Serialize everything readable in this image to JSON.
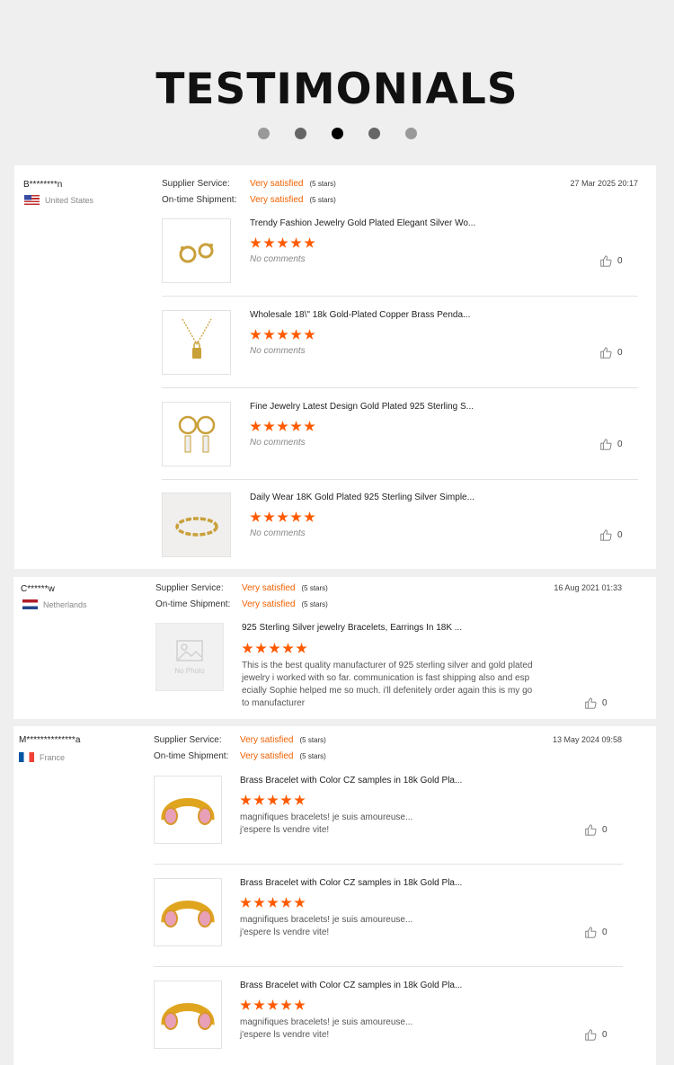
{
  "title": "TESTIMONIALS",
  "colors": {
    "accent": "#f06000",
    "star": "#ff5a00",
    "background": "#efefef"
  },
  "labels": {
    "supplier_service": "Supplier Service:",
    "ontime_shipment": "On-time Shipment:",
    "very_satisfied": "Very satisfied",
    "five_stars": "(5 stars)",
    "no_comments": "No comments",
    "no_photo": "No Photo"
  },
  "reviews": [
    {
      "user": "B********n",
      "country": "United States",
      "flag": "us-flag",
      "date": "27 Mar 2025 20:17",
      "items": [
        {
          "name": "Trendy Fashion Jewelry Gold Plated Elegant Silver Wo...",
          "comment": "No comments",
          "likes": "0",
          "rating": 5
        },
        {
          "name": "Wholesale 18\\\" 18k Gold-Plated Copper Brass Penda...",
          "comment": "No comments",
          "likes": "0",
          "rating": 5
        },
        {
          "name": "Fine Jewelry Latest Design Gold Plated 925 Sterling S...",
          "comment": "No comments",
          "likes": "0",
          "rating": 5
        },
        {
          "name": "Daily Wear 18K Gold Plated 925 Sterling Silver Simple...",
          "comment": "No comments",
          "likes": "0",
          "rating": 5
        }
      ]
    },
    {
      "user": "C******w",
      "country": "Netherlands",
      "flag": "nl-flag",
      "date": "16 Aug 2021 01:33",
      "items": [
        {
          "name": "925 Sterling Silver jewelry Bracelets, Earrings In 18K ...",
          "comment_lines": [
            "This is the best quality manufacturer of 925 sterling silver and gold plated",
            "jewelry i worked with so far. communication is fast shipping also and esp",
            "ecially Sophie helped me so much. i'll defenitely order again this is my go",
            "to manufacturer"
          ],
          "likes": "0",
          "rating": 5
        }
      ]
    },
    {
      "user": "M**************a",
      "country": "France",
      "flag": "fr-flag",
      "date": "13 May 2024 09:58",
      "items": [
        {
          "name": "Brass Bracelet with Color CZ samples in 18k Gold Pla...",
          "comment_lines": [
            "magnifiques bracelets! je suis amoureuse...",
            "j'espere ls vendre vite!"
          ],
          "likes": "0",
          "rating": 5
        },
        {
          "name": "Brass Bracelet with Color CZ samples in 18k Gold Pla...",
          "comment_lines": [
            "magnifiques bracelets! je suis amoureuse...",
            "j'espere ls vendre vite!"
          ],
          "likes": "0",
          "rating": 5
        },
        {
          "name": "Brass Bracelet with Color CZ samples in 18k Gold Pla...",
          "comment_lines": [
            "magnifiques bracelets! je suis amoureuse...",
            "j'espere ls vendre vite!"
          ],
          "likes": "0",
          "rating": 5
        }
      ]
    }
  ]
}
